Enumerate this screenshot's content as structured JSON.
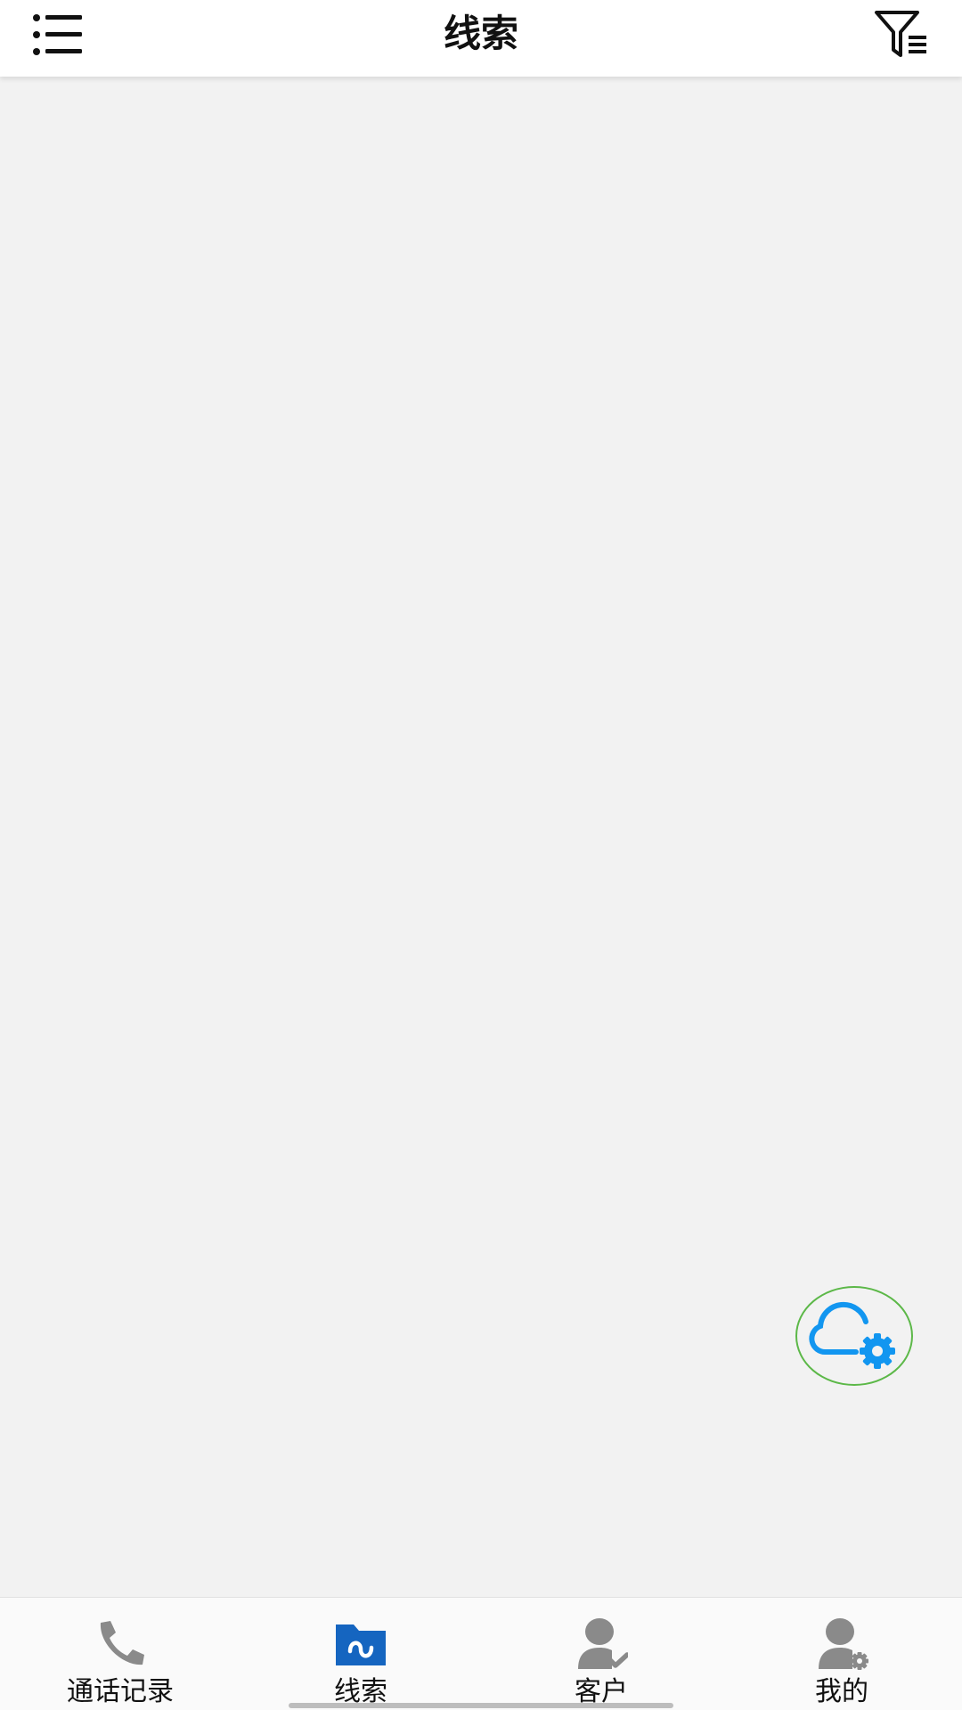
{
  "header": {
    "title": "线索",
    "menu_icon": "list-menu-icon",
    "filter_icon": "filter-list-icon"
  },
  "fab": {
    "icon": "cloud-settings-icon",
    "icon_color": "#1296f0",
    "border_color": "#5cb848"
  },
  "bottom_nav": {
    "active_color": "#1565c0",
    "inactive_color": "#8a8a8a",
    "items": [
      {
        "label": "通话记录",
        "icon": "phone-icon",
        "active": false
      },
      {
        "label": "线索",
        "icon": "folder-wave-icon",
        "active": true
      },
      {
        "label": "客户",
        "icon": "user-check-icon",
        "active": false
      },
      {
        "label": "我的",
        "icon": "user-settings-icon",
        "active": false
      }
    ]
  }
}
